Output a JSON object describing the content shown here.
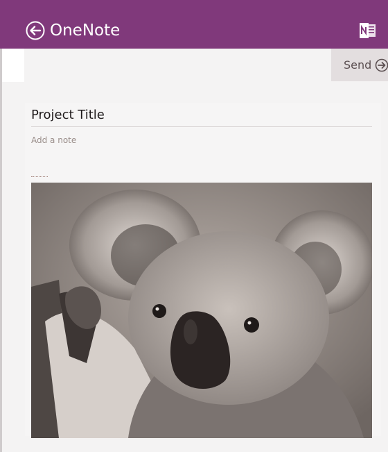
{
  "header": {
    "app_title": "OneNote",
    "back_icon": "back-arrow-icon",
    "onenote_icon": "onenote-logo-icon",
    "background_color": "#80397b"
  },
  "toolbar": {
    "send_label": "Send",
    "send_icon": "arrow-right-circle-icon"
  },
  "note": {
    "title": "Project Title",
    "note_placeholder": "Add a note"
  },
  "attachment": {
    "type": "image",
    "subject": "koala photo"
  }
}
